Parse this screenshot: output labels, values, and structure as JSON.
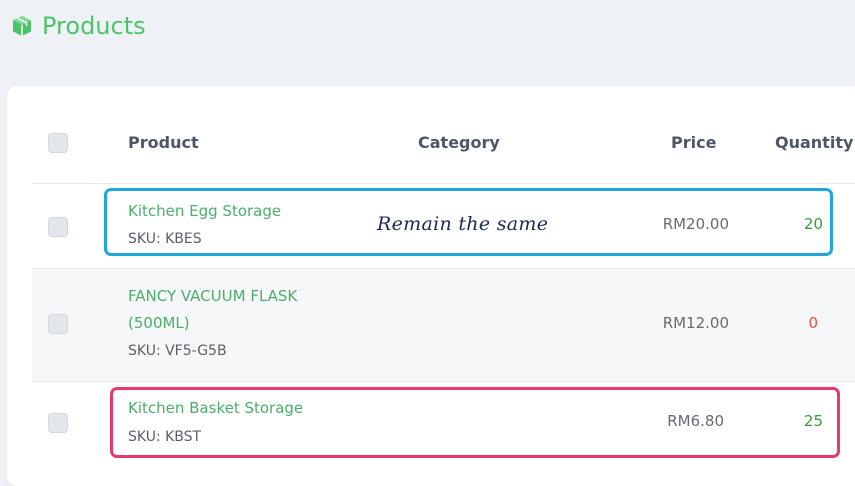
{
  "page": {
    "title": "Products",
    "icon": "box-icon"
  },
  "table": {
    "headers": {
      "product": "Product",
      "category": "Category",
      "price": "Price",
      "quantity": "Quantity"
    },
    "rows": [
      {
        "name": "Kitchen Egg Storage",
        "sku": "SKU: KBES",
        "category": "",
        "price": "RM20.00",
        "quantity": "20",
        "quantity_color": "#3a9b3a"
      },
      {
        "name_line1": "FANCY VACUUM FLASK",
        "name_line2": "(500ML)",
        "sku": "SKU: VF5-G5B",
        "category": "",
        "price": "RM12.00",
        "quantity": "0",
        "quantity_color": "#e84a4a"
      },
      {
        "name": "Kitchen Basket Storage",
        "sku": "SKU: KBST",
        "category": "",
        "price": "RM6.80",
        "quantity": "25",
        "quantity_color": "#3a9b3a"
      }
    ]
  },
  "annotations": {
    "note": "Remain the same",
    "blue_box_color": "#1fa6de",
    "pink_box_color": "#e8396a"
  },
  "colors": {
    "accent": "#4cc36b",
    "product_link": "#4cae6a"
  }
}
